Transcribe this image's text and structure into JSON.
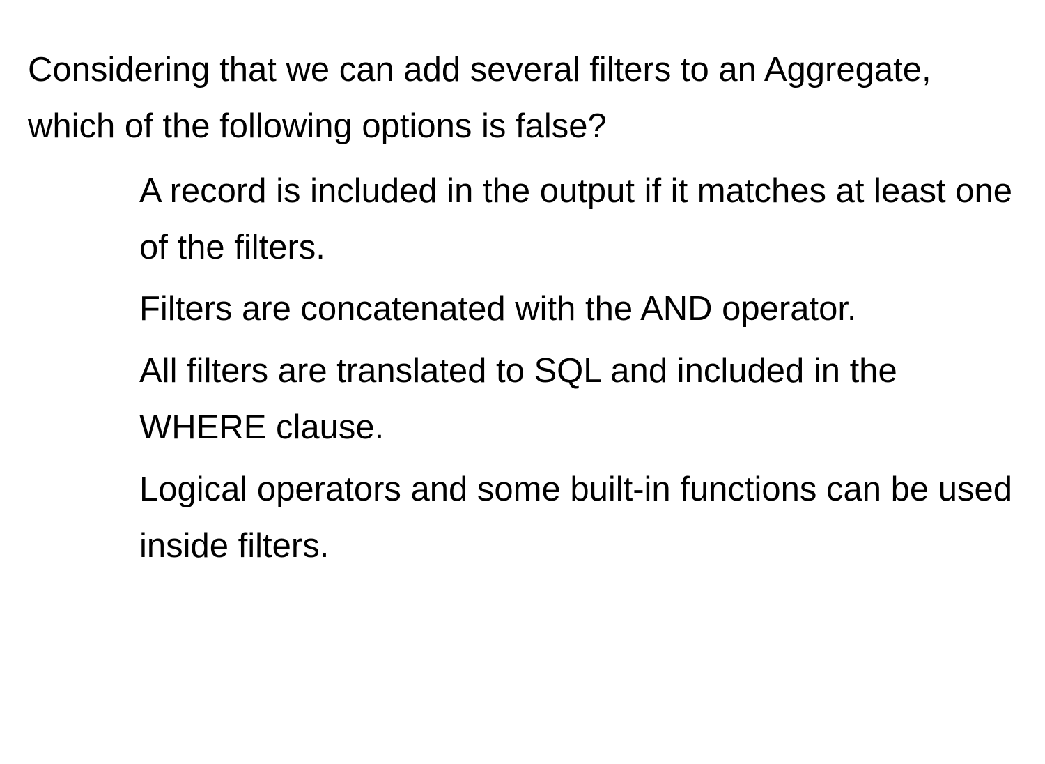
{
  "question": "Considering that we can add several filters to an Aggregate, which of the following options is false?",
  "options": [
    "A record is included in the output if it matches at least one of the filters.",
    "Filters are concatenated with the AND operator.",
    "All filters are translated to SQL and included in the WHERE clause.",
    "Logical operators and some built-in functions can be used inside filters."
  ]
}
